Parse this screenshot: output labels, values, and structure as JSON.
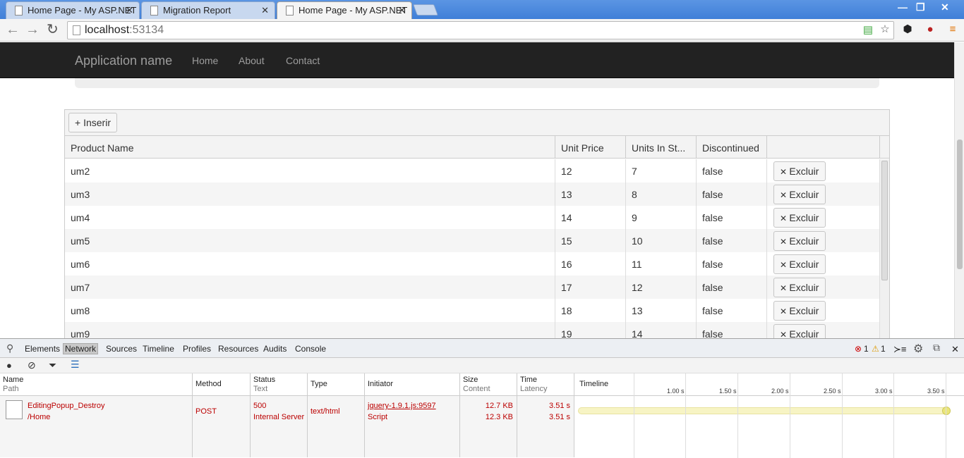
{
  "browser": {
    "tabs": [
      {
        "title": "Home Page - My ASP.NET"
      },
      {
        "title": "Migration Report"
      },
      {
        "title": "Home Page - My ASP.NET"
      }
    ],
    "url_host": "localhost",
    "url_port": ":53134",
    "window_controls": {
      "minimize": "—",
      "restore": "❐",
      "close": "✕"
    }
  },
  "app": {
    "brand": "Application name",
    "nav": [
      "Home",
      "About",
      "Contact"
    ]
  },
  "grid": {
    "insert_label": "Inserir",
    "columns": [
      "Product Name",
      "Unit Price",
      "Units In St...",
      "Discontinued"
    ],
    "delete_label": "Excluir",
    "rows": [
      {
        "name": "um2",
        "price": "12",
        "units": "7",
        "disc": "false"
      },
      {
        "name": "um3",
        "price": "13",
        "units": "8",
        "disc": "false"
      },
      {
        "name": "um4",
        "price": "14",
        "units": "9",
        "disc": "false"
      },
      {
        "name": "um5",
        "price": "15",
        "units": "10",
        "disc": "false"
      },
      {
        "name": "um6",
        "price": "16",
        "units": "11",
        "disc": "false"
      },
      {
        "name": "um7",
        "price": "17",
        "units": "12",
        "disc": "false"
      },
      {
        "name": "um8",
        "price": "18",
        "units": "13",
        "disc": "false"
      },
      {
        "name": "um9",
        "price": "19",
        "units": "14",
        "disc": "false"
      }
    ]
  },
  "devtools": {
    "tabs": [
      "Elements",
      "Network",
      "Sources",
      "Timeline",
      "Profiles",
      "Resources",
      "Audits",
      "Console"
    ],
    "errors": "1",
    "warnings": "1",
    "columns": {
      "name": "Name",
      "path": "Path",
      "method": "Method",
      "status": "Status",
      "text": "Text",
      "type": "Type",
      "initiator": "Initiator",
      "size": "Size",
      "content": "Content",
      "time": "Time",
      "latency": "Latency",
      "timeline": "Timeline"
    },
    "ticks": [
      "1.00 s",
      "1.50 s",
      "2.00 s",
      "2.50 s",
      "3.00 s",
      "3.50 s"
    ],
    "request": {
      "name": "EditingPopup_Destroy",
      "path": "/Home",
      "method": "POST",
      "status": "500",
      "status_text": "Internal Server",
      "type": "text/html",
      "initiator": "jquery-1.9.1.js:9597",
      "initiator_type": "Script",
      "size": "12.7 KB",
      "content": "12.3 KB",
      "time": "3.51 s",
      "latency": "3.51 s"
    }
  }
}
